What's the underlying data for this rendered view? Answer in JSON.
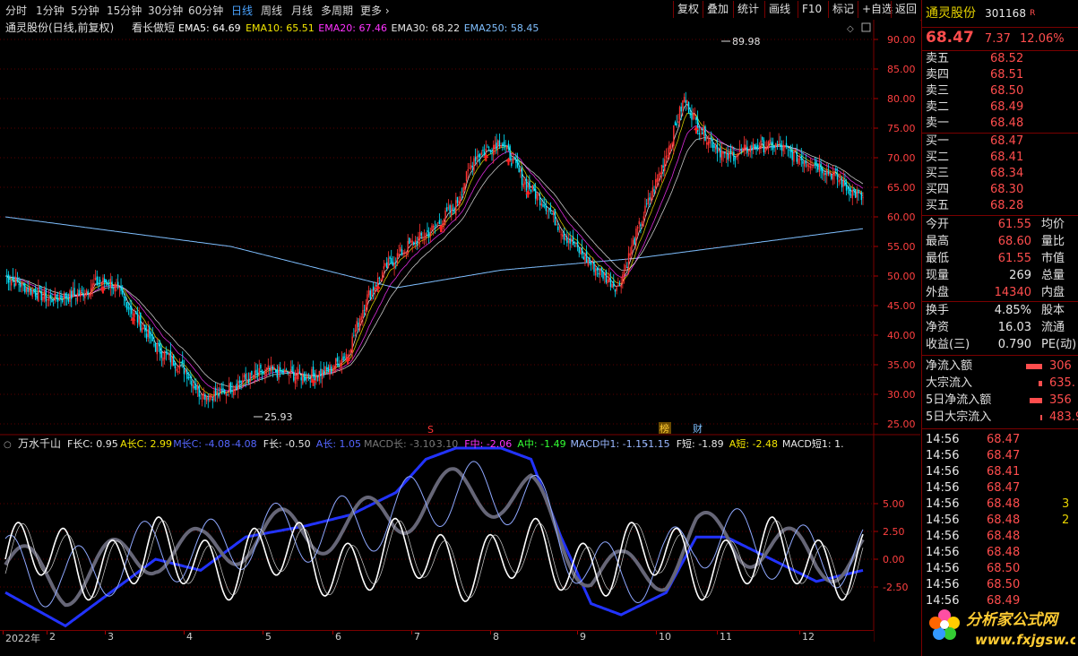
{
  "toolbar": {
    "periods": [
      "分时",
      "1分钟",
      "5分钟",
      "15分钟",
      "30分钟",
      "60分钟",
      "日线",
      "周线",
      "月线",
      "多周期",
      "更多"
    ],
    "active_period": "日线",
    "buttons": [
      "复权",
      "叠加",
      "统计",
      "画线",
      "F10",
      "标记",
      "+自选",
      "返回"
    ]
  },
  "chart_header": {
    "title": "通灵股份(日线,前复权)",
    "indicator": "看长做短",
    "ema": [
      {
        "label": "EMA5: 64.69",
        "color": "#ffffff"
      },
      {
        "label": "EMA10: 65.51",
        "color": "#f2e600"
      },
      {
        "label": "EMA20: 67.46",
        "color": "#ff33ff"
      },
      {
        "label": "EMA30: 68.22",
        "color": "#e6e6e6"
      },
      {
        "label": "EMA250: 58.45",
        "color": "#7fbfff"
      }
    ]
  },
  "price_axis": [
    "90.00",
    "85.00",
    "80.00",
    "75.00",
    "70.00",
    "65.00",
    "60.00",
    "55.00",
    "50.00",
    "45.00",
    "40.00",
    "35.00",
    "30.00",
    "25.00"
  ],
  "annotations": {
    "high": "89.98",
    "low": "25.93",
    "marker_s": "S",
    "marker_bang": "榜",
    "marker_cai": "财"
  },
  "indicator_header": {
    "name": "万水千山",
    "items": [
      {
        "label": "F长C: 0.95",
        "color": "#e8e8e8"
      },
      {
        "label": "A长C: 2.99",
        "color": "#f2e600"
      },
      {
        "label": "M长C: -4.08",
        "color": "#5566ff"
      },
      {
        "label": "-4.08",
        "color": "#5566ff"
      },
      {
        "label": "F长: -0.50",
        "color": "#e8e8e8"
      },
      {
        "label": "A长: 1.05",
        "color": "#5566ff"
      },
      {
        "label": "MACD长: -3.10",
        "color": "#777777"
      },
      {
        "label": "-3.10",
        "color": "#777777"
      },
      {
        "label": "F中: -2.06",
        "color": "#ff33ff"
      },
      {
        "label": "A中: -1.49",
        "color": "#33ff33"
      },
      {
        "label": "MACD中1: -1.15",
        "color": "#9ab8ff"
      },
      {
        "label": "-1.15",
        "color": "#9ab8ff"
      },
      {
        "label": "F短: -1.89",
        "color": "#e8e8e8"
      },
      {
        "label": "A短: -2.48",
        "color": "#f2e600"
      },
      {
        "label": "MACD短1: 1.",
        "color": "#e8e8e8"
      }
    ]
  },
  "ind_axis": [
    "5.00",
    "2.50",
    "0.00",
    "-2.50"
  ],
  "x_axis": [
    "2022年",
    "2",
    "3",
    "4",
    "5",
    "6",
    "7",
    "8",
    "9",
    "10",
    "11",
    "12"
  ],
  "stock": {
    "name": "通灵股份",
    "code": "301168",
    "r_mark": "R",
    "price": "68.47",
    "change": "7.37",
    "pct": "12.06%"
  },
  "orderbook": {
    "sell": [
      {
        "label": "卖五",
        "price": "68.52"
      },
      {
        "label": "卖四",
        "price": "68.51"
      },
      {
        "label": "卖三",
        "price": "68.50"
      },
      {
        "label": "卖二",
        "price": "68.49"
      },
      {
        "label": "卖一",
        "price": "68.48"
      }
    ],
    "buy": [
      {
        "label": "买一",
        "price": "68.47"
      },
      {
        "label": "买二",
        "price": "68.41"
      },
      {
        "label": "买三",
        "price": "68.34"
      },
      {
        "label": "买四",
        "price": "68.30"
      },
      {
        "label": "买五",
        "price": "68.28"
      }
    ]
  },
  "quote": [
    {
      "l1": "今开",
      "v1": "61.55",
      "c1": "red",
      "l2": "均价"
    },
    {
      "l1": "最高",
      "v1": "68.60",
      "c1": "red",
      "l2": "量比"
    },
    {
      "l1": "最低",
      "v1": "61.55",
      "c1": "red",
      "l2": "市值"
    },
    {
      "l1": "现量",
      "v1": "269",
      "c1": "wht",
      "l2": "总量"
    },
    {
      "l1": "外盘",
      "v1": "14340",
      "c1": "red",
      "l2": "内盘"
    }
  ],
  "stats": [
    {
      "l1": "换手",
      "v1": "4.85%",
      "l2": "股本"
    },
    {
      "l1": "净资",
      "v1": "16.03",
      "l2": "流通"
    },
    {
      "l1": "收益(三)",
      "v1": "0.790",
      "l2": "PE(动)"
    }
  ],
  "flows": [
    {
      "label": "净流入额",
      "value": "306"
    },
    {
      "label": "大宗流入",
      "value": "635."
    },
    {
      "label": "5日净流入额",
      "value": "356"
    },
    {
      "label": "5日大宗流入",
      "value": "483.9"
    }
  ],
  "ticks": [
    {
      "time": "14:56",
      "price": "68.47",
      "vol": ""
    },
    {
      "time": "14:56",
      "price": "68.47",
      "vol": ""
    },
    {
      "time": "14:56",
      "price": "68.41",
      "vol": ""
    },
    {
      "time": "14:56",
      "price": "68.47",
      "vol": ""
    },
    {
      "time": "14:56",
      "price": "68.48",
      "vol": "3"
    },
    {
      "time": "14:56",
      "price": "68.48",
      "vol": "2"
    },
    {
      "time": "14:56",
      "price": "68.48",
      "vol": ""
    },
    {
      "time": "14:56",
      "price": "68.48",
      "vol": ""
    },
    {
      "time": "14:56",
      "price": "68.50",
      "vol": ""
    },
    {
      "time": "14:56",
      "price": "68.50",
      "vol": ""
    },
    {
      "time": "14:56",
      "price": "68.49",
      "vol": ""
    }
  ],
  "logo": {
    "cn": "分析家公式网",
    "url": "www.fxjgsw.com"
  },
  "colors": {
    "up": "#ff3333",
    "down": "#00e5ff",
    "grid": "#7a0000",
    "ema250": "#7fbfff"
  }
}
